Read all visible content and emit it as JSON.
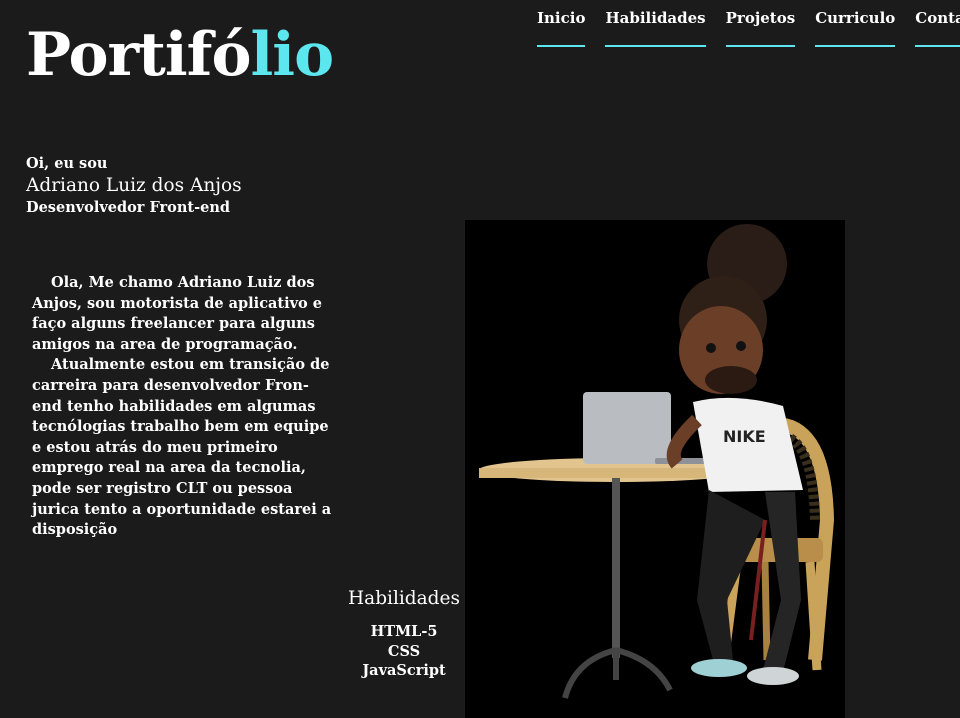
{
  "header": {
    "logo": {
      "part1": "Portifó",
      "part2": "lio",
      "accent_color": "#5ce6ee"
    },
    "nav": [
      {
        "label": "Inicio"
      },
      {
        "label": "Habilidades"
      },
      {
        "label": "Projetos"
      },
      {
        "label": "Curriculo"
      },
      {
        "label": "Contatos"
      }
    ]
  },
  "intro": {
    "greeting": "Oi, eu sou",
    "name": "Adriano Luiz dos Anjos",
    "role": "Desenvolvedor Front-end"
  },
  "bio": {
    "paragraph1": "Ola, Me chamo Adriano Luiz dos Anjos, sou motorista de aplicativo e faço alguns freelancer para alguns amigos na area de programação.",
    "paragraph2": "Atualmente estou em transição de carreira para desenvolvedor Fron-end tenho habilidades em algumas tecnólogias trabalho bem em equipe e estou atrás do meu primeiro emprego real na area da tecnolia, pode ser registro CLT ou pessoa jurica tento a oportunidade estarei a disposição"
  },
  "photo": {
    "description_icon": "avatar-at-laptop-illustration"
  },
  "skills": {
    "title": "Habilidades",
    "items": [
      "HTML-5",
      "CSS",
      "JavaScript"
    ]
  },
  "colors": {
    "background": "#1b1b1b",
    "accent": "#5ce6ee",
    "text": "#ffffff"
  }
}
